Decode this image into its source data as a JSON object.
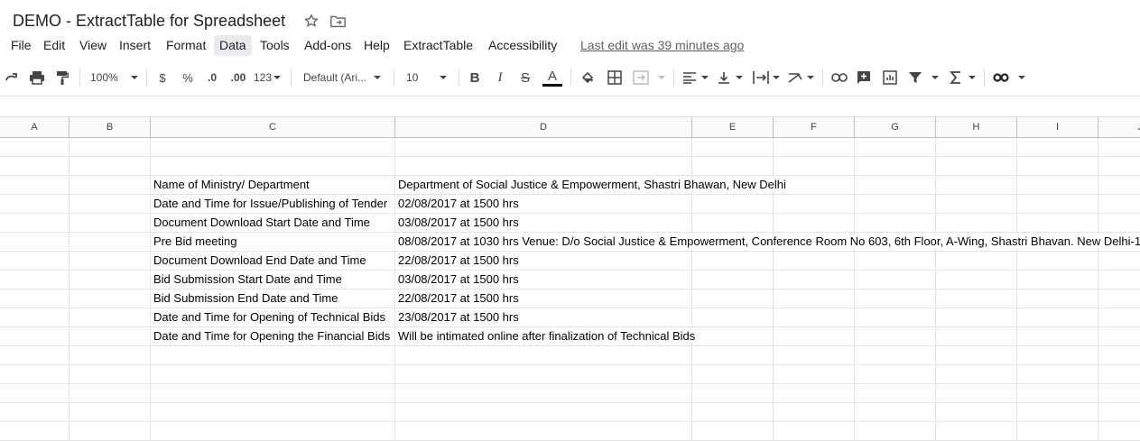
{
  "app": {
    "doc_title": "DEMO - ExtractTable for Spreadsheet",
    "last_edit": "Last edit was 39 minutes ago"
  },
  "menu": [
    "File",
    "Edit",
    "View",
    "Insert",
    "Format",
    "Data",
    "Tools",
    "Add-ons",
    "Help",
    "ExtractTable",
    "Accessibility"
  ],
  "menu_active": "Data",
  "toolbar": {
    "zoom": "100%",
    "currency": "$",
    "percent": "%",
    "dec_decrease": ".0",
    "dec_increase": ".00",
    "more_formats": "123",
    "font": "Default (Ari...",
    "font_size": "10",
    "bold": "B",
    "italic": "I",
    "strike": "S",
    "text_color_glyph": "A",
    "text_color": "#000000"
  },
  "columns": [
    "A",
    "B",
    "C",
    "D",
    "E",
    "F",
    "G",
    "H",
    "I",
    "J"
  ],
  "rows": [
    {
      "label": "Name of Ministry/ Department",
      "value": "Department of Social Justice & Empowerment, Shastri Bhawan, New Delhi"
    },
    {
      "label": "Date and Time for Issue/Publishing of Tender",
      "value": "02/08/2017 at 1500 hrs"
    },
    {
      "label": "Document Download Start Date and Time",
      "value": "03/08/2017 at 1500 hrs"
    },
    {
      "label": "Pre Bid meeting",
      "value": "08/08/2017 at 1030 hrs Venue: D/o Social Justice & Empowerment, Conference Room No 603, 6th Floor, A-Wing, Shastri Bhavan. New Delhi-1"
    },
    {
      "label": "Document Download End Date and Time",
      "value": "22/08/2017 at 1500 hrs"
    },
    {
      "label": "Bid Submission Start Date and Time",
      "value": "03/08/2017 at 1500 hrs"
    },
    {
      "label": "Bid Submission End Date and Time",
      "value": "22/08/2017 at 1500 hrs"
    },
    {
      "label": "Date and Time for Opening of Technical Bids",
      "value": "23/08/2017 at 1500 hrs"
    },
    {
      "label": "Date and Time for Opening the Financial Bids",
      "value": "Will be intimated online after finalization of Technical Bids"
    }
  ]
}
